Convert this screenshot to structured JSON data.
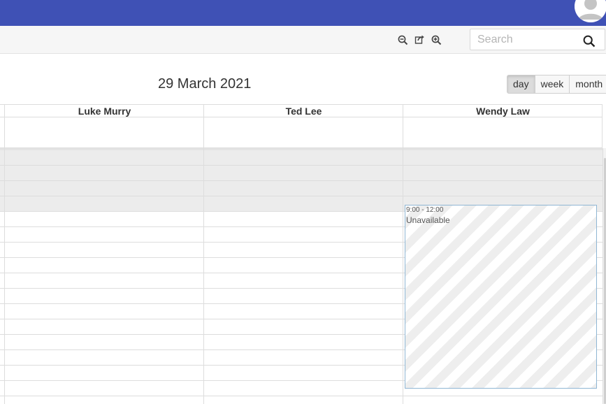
{
  "toolbar": {
    "search_placeholder": "Search",
    "icons": [
      "zoom-out-icon",
      "export-icon",
      "zoom-in-icon",
      "search-icon"
    ]
  },
  "calendar": {
    "date": "29 March 2021",
    "views": [
      "day",
      "week",
      "month"
    ],
    "active_view": "day",
    "resources": [
      "Luke Murry",
      "Ted Lee",
      "Wendy Law"
    ],
    "event": {
      "time": "9:00 - 12:00",
      "title": "Unavailable"
    }
  },
  "colors": {
    "topbar": "#3f51b5",
    "event_border": "#8fb6d4",
    "offhours": "#ececec"
  }
}
